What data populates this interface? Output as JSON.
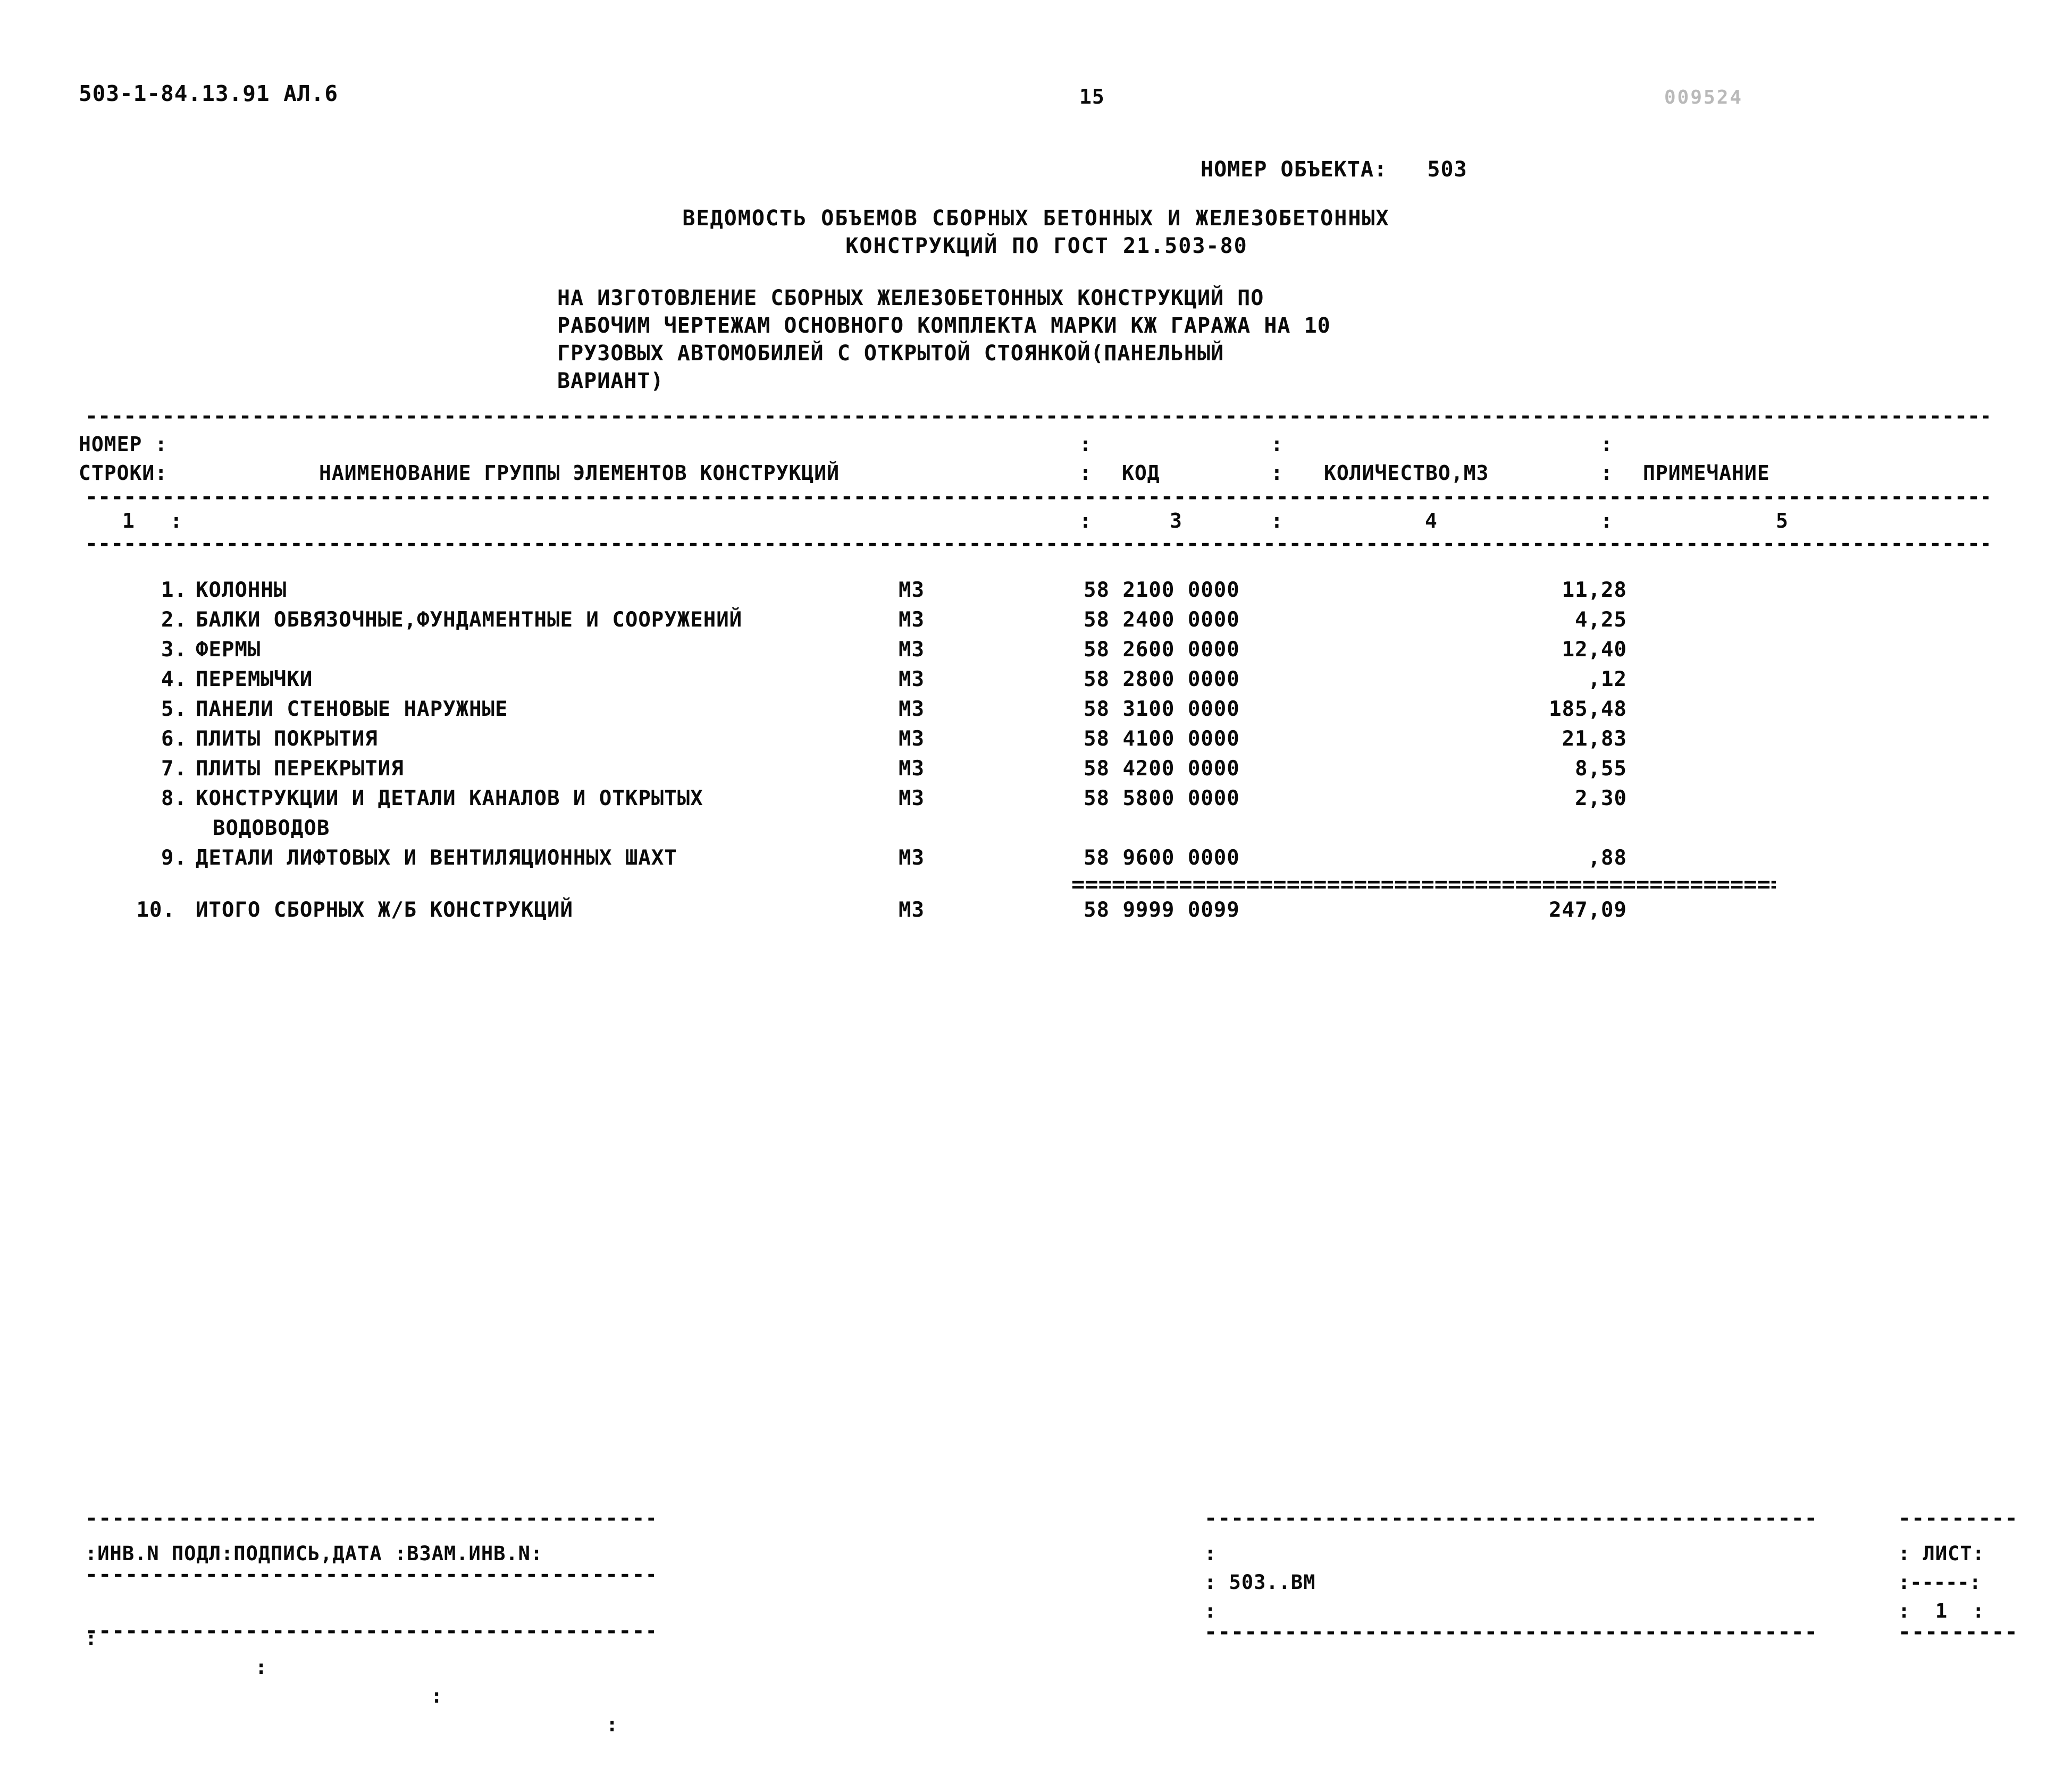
{
  "header": {
    "doc_code": "503-1-84.13.91 АЛ.6",
    "page_number": "15",
    "faint_stamp": "009524"
  },
  "object": {
    "label": "НОМЕР ОБЪЕКТА:",
    "value": "503"
  },
  "title": {
    "line1": "ВЕДОМОСТЬ ОБЪЕМОВ СБОРНЫХ БЕТОННЫХ И ЖЕЛЕЗОБЕТОННЫХ",
    "line2": "КОНСТРУКЦИЙ ПО ГОСТ 21.503-80"
  },
  "subtitle": {
    "line1": "НА ИЗГОТОВЛЕНИЕ СБОРНЫХ ЖЕЛЕЗОБЕТОННЫХ КОНСТРУКЦИЙ ПО",
    "line2": "РАБОЧИМ ЧЕРТЕЖАМ ОСНОВНОГО КОМПЛЕКТА МАРКИ КЖ ГАРАЖА НА 10",
    "line3": "ГРУЗОВЫХ АВТОМОБИЛЕЙ С ОТКРЫТОЙ СТОЯНКОЙ(ПАНЕЛЬНЫЙ",
    "line4": "ВАРИАНТ)"
  },
  "table": {
    "headers": {
      "number_l1": "НОМЕР :",
      "number_l2": "СТРОКИ:",
      "name": "НАИМЕНОВАНИЕ ГРУППЫ ЭЛЕМЕНТОВ КОНСТРУКЦИЙ",
      "code": "КОД",
      "quantity": "КОЛИЧЕСТВО,М3",
      "note": "ПРИМЕЧАНИЕ",
      "separator": ":"
    },
    "column_numbers": {
      "c1": "1",
      "c3": "3",
      "c4": "4",
      "c5": "5"
    },
    "rows": [
      {
        "idx": "1.",
        "name": "КОЛОННЫ",
        "cont": "",
        "unit": "М3",
        "code": "58 2100 0000",
        "qty": "11,28",
        "note": ""
      },
      {
        "idx": "2.",
        "name": "БАЛКИ ОБВЯЗОЧНЫЕ,ФУНДАМЕНТНЫЕ И СООРУЖЕНИЙ",
        "cont": "",
        "unit": "М3",
        "code": "58 2400 0000",
        "qty": "4,25",
        "note": ""
      },
      {
        "idx": "3.",
        "name": "ФЕРМЫ",
        "cont": "",
        "unit": "М3",
        "code": "58 2600 0000",
        "qty": "12,40",
        "note": ""
      },
      {
        "idx": "4.",
        "name": "ПЕРЕМЫЧКИ",
        "cont": "",
        "unit": "М3",
        "code": "58 2800 0000",
        "qty": ",12",
        "note": ""
      },
      {
        "idx": "5.",
        "name": "ПАНЕЛИ СТЕНОВЫЕ НАРУЖНЫЕ",
        "cont": "",
        "unit": "М3",
        "code": "58 3100 0000",
        "qty": "185,48",
        "note": ""
      },
      {
        "idx": "6.",
        "name": "ПЛИТЫ ПОКРЫТИЯ",
        "cont": "",
        "unit": "М3",
        "code": "58 4100 0000",
        "qty": "21,83",
        "note": ""
      },
      {
        "idx": "7.",
        "name": "ПЛИТЫ ПЕРЕКРЫТИЯ",
        "cont": "",
        "unit": "М3",
        "code": "58 4200 0000",
        "qty": "8,55",
        "note": ""
      },
      {
        "idx": "8.",
        "name": "КОНСТРУКЦИИ И ДЕТАЛИ КАНАЛОВ И ОТКРЫТЫХ",
        "cont": "ВОДОВОДОВ",
        "unit": "М3",
        "code": "58 5800 0000",
        "qty": "2,30",
        "note": ""
      },
      {
        "idx": "9.",
        "name": "ДЕТАЛИ ЛИФТОВЫХ И ВЕНТИЛЯЦИОННЫХ ШАХТ",
        "cont": "",
        "unit": "М3",
        "code": "58 9600 0000",
        "qty": ",88",
        "note": ""
      }
    ],
    "total_row": {
      "idx": "10.",
      "name": "ИТОГО СБОРНЫХ Ж/Б КОНСТРУКЦИЙ",
      "unit": "М3",
      "code": "58 9999 0099",
      "qty": "247,09",
      "note": ""
    }
  },
  "footer": {
    "stamp_fields": ":ИНВ.N ПОДЛ:ПОДПИСЬ,ДАТА :ВЗАМ.ИНВ.N:",
    "drawing_code": ": 503..ВМ",
    "sheet_label": ": ЛИСТ:",
    "sheet_value": ":  1  :",
    "col_marks": [
      ":",
      ":",
      ":",
      ":"
    ],
    "mid_mark": ":"
  },
  "colors": {
    "ink": "#0a0a0a",
    "paper": "#ffffff",
    "faint": "#b9b9b9"
  }
}
